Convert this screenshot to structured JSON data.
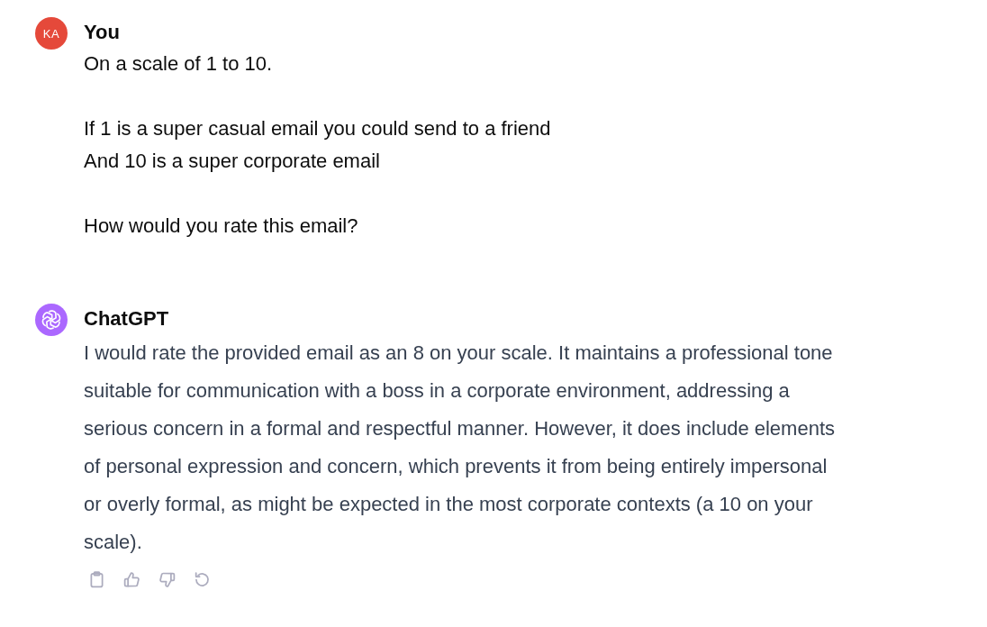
{
  "messages": [
    {
      "kind": "user",
      "author": "You",
      "avatar": {
        "initials": "KA"
      },
      "text": "On a scale of 1 to 10.\n\nIf 1 is a super casual email you could send to a friend\nAnd 10 is a super corporate email\n\nHow would you rate this email?"
    },
    {
      "kind": "assistant",
      "author": "ChatGPT",
      "text": "I would rate the provided email as an 8 on your scale. It maintains a professional tone suitable for communication with a boss in a corporate environment, addressing a serious concern in a formal and respectful manner. However, it does include elements of personal expression and concern, which prevents it from being entirely impersonal or overly formal, as might be expected in the most corporate contexts (a 10 on your scale)."
    }
  ]
}
